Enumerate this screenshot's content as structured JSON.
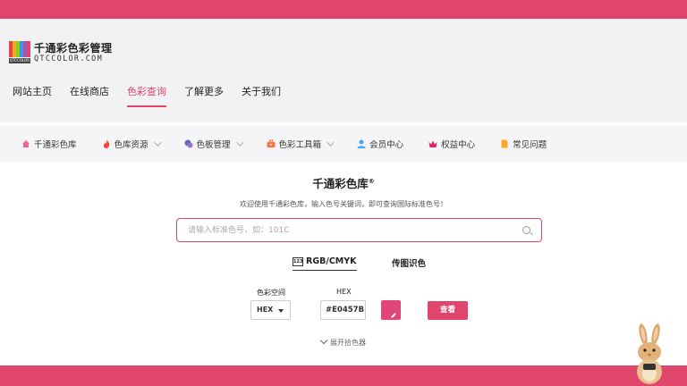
{
  "brand": {
    "name_cn": "千通彩色彩管理",
    "name_en": "QTCCOLOR.COM",
    "logo_caption": "QTCCOLOR",
    "accent": "#e0456c"
  },
  "nav": {
    "items": [
      {
        "label": "网站主页",
        "active": false
      },
      {
        "label": "在线商店",
        "active": false
      },
      {
        "label": "色彩查询",
        "active": true
      },
      {
        "label": "了解更多",
        "active": false
      },
      {
        "label": "关于我们",
        "active": false
      }
    ]
  },
  "subnav": {
    "items": [
      {
        "label": "千通彩色库",
        "icon": "home-icon",
        "dropdown": false
      },
      {
        "label": "色库资源",
        "icon": "fire-icon",
        "dropdown": true
      },
      {
        "label": "色板管理",
        "icon": "palette-icon",
        "dropdown": true
      },
      {
        "label": "色彩工具箱",
        "icon": "toolbox-icon",
        "dropdown": true
      },
      {
        "label": "会员中心",
        "icon": "user-icon",
        "dropdown": false
      },
      {
        "label": "权益中心",
        "icon": "crown-icon",
        "dropdown": false
      },
      {
        "label": "常见问题",
        "icon": "document-icon",
        "dropdown": false
      }
    ]
  },
  "main": {
    "title": "千通彩色库",
    "title_mark": "®",
    "subtitle": "欢迎使用千通彩色库，输入色号关键词，即可查询国际标准色号！",
    "search": {
      "placeholder": "请输入标准色号，如：101C",
      "value": ""
    },
    "tabs": {
      "rgb_icon_text": "123",
      "rgb_label": "RGB/CMYK",
      "image_label": "传图识色"
    },
    "color_space": {
      "label": "色彩空间",
      "value": "HEX"
    },
    "hex": {
      "label": "HEX",
      "value": "#E0457B",
      "swatch_color": "#E0457B"
    },
    "view_button": "查看",
    "expand_label": "展开拾色器"
  }
}
